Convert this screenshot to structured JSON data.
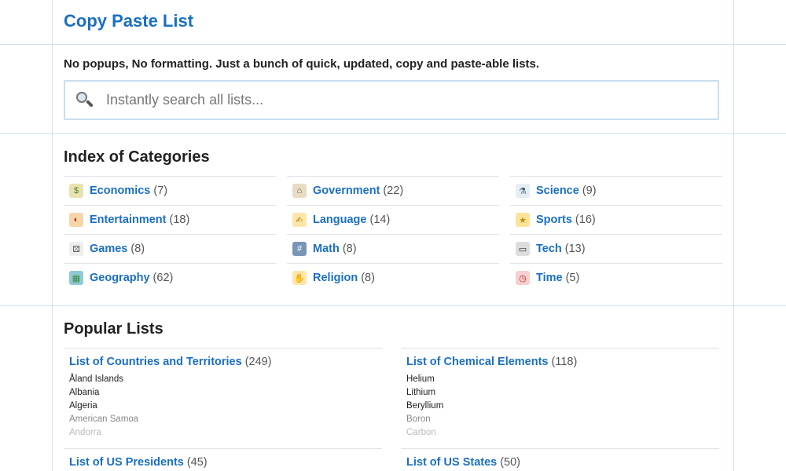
{
  "site": {
    "title": "Copy Paste List",
    "tagline": "No popups, No formatting. Just a bunch of quick, updated, copy and paste-able lists."
  },
  "search": {
    "placeholder": "Instantly search all lists..."
  },
  "categories": {
    "heading": "Index of Categories",
    "columns": [
      [
        {
          "label": "Economics",
          "count": "(7)",
          "icon": "money-icon"
        },
        {
          "label": "Entertainment",
          "count": "(18)",
          "icon": "theater-masks-icon"
        },
        {
          "label": "Games",
          "count": "(8)",
          "icon": "dice-icon"
        },
        {
          "label": "Geography",
          "count": "(62)",
          "icon": "map-icon"
        }
      ],
      [
        {
          "label": "Government",
          "count": "(22)",
          "icon": "classical-building-icon"
        },
        {
          "label": "Language",
          "count": "(14)",
          "icon": "writing-hand-icon"
        },
        {
          "label": "Math",
          "count": "(8)",
          "icon": "numbers-icon"
        },
        {
          "label": "Religion",
          "count": "(8)",
          "icon": "praying-hands-icon"
        }
      ],
      [
        {
          "label": "Science",
          "count": "(9)",
          "icon": "microscope-icon"
        },
        {
          "label": "Sports",
          "count": "(16)",
          "icon": "medal-icon"
        },
        {
          "label": "Tech",
          "count": "(13)",
          "icon": "laptop-icon"
        },
        {
          "label": "Time",
          "count": "(5)",
          "icon": "alarm-clock-icon"
        }
      ]
    ]
  },
  "popular": {
    "heading": "Popular Lists",
    "lists": [
      {
        "title": "List of Countries and Territories",
        "count": "(249)",
        "items": [
          "Åland Islands",
          "Albania",
          "Algeria",
          "American Samoa",
          "Andorra"
        ]
      },
      {
        "title": "List of Chemical Elements",
        "count": "(118)",
        "items": [
          "Helium",
          "Lithium",
          "Beryllium",
          "Boron",
          "Carbon"
        ]
      },
      {
        "title": "List of US Presidents",
        "count": "(45)",
        "items": []
      },
      {
        "title": "List of US States",
        "count": "(50)",
        "items": []
      }
    ]
  },
  "colors": {
    "link": "#1a6fc4",
    "border": "#cfe0ee",
    "search_border": "#c7ddef"
  }
}
